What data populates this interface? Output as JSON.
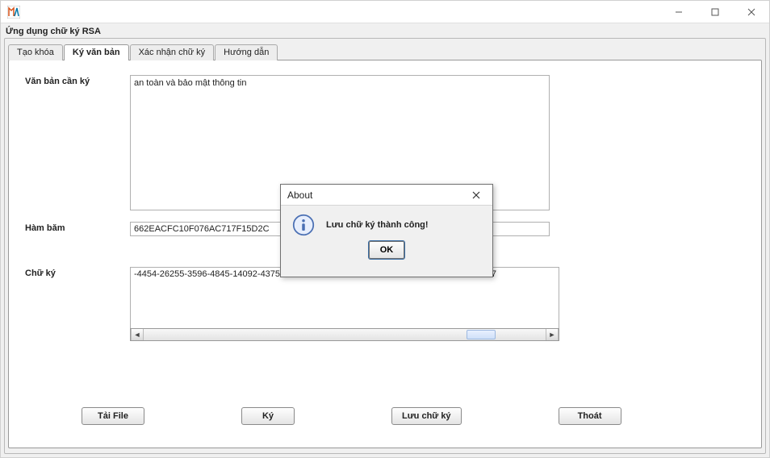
{
  "window": {
    "title": ""
  },
  "panel_title": "Ứng dụng chữ ký RSA",
  "tabs": [
    {
      "label": "Tạo khóa"
    },
    {
      "label": "Ký văn bản"
    },
    {
      "label": "Xác nhận chữ ký"
    },
    {
      "label": "Hướng dẫn"
    }
  ],
  "active_tab_index": 1,
  "form": {
    "text_label": "Văn bản cần ký",
    "text_value": "an toàn và bảo mật thông tin",
    "hash_label": "Hàm băm",
    "hash_value": "662EACFC10F076AC717F15D2C",
    "sig_label": "Chữ ký",
    "sig_value": "-4454-26255-3596-4845-14092-43750-55290-51556-42009-26255-43750-9377-31878-9377"
  },
  "buttons": {
    "load": "Tải File",
    "sign": "Ký",
    "save_sig": "Lưu chữ ký",
    "exit": "Thoát"
  },
  "modal": {
    "title": "About",
    "message": "Lưu chữ ký thành công!",
    "ok": "OK"
  }
}
